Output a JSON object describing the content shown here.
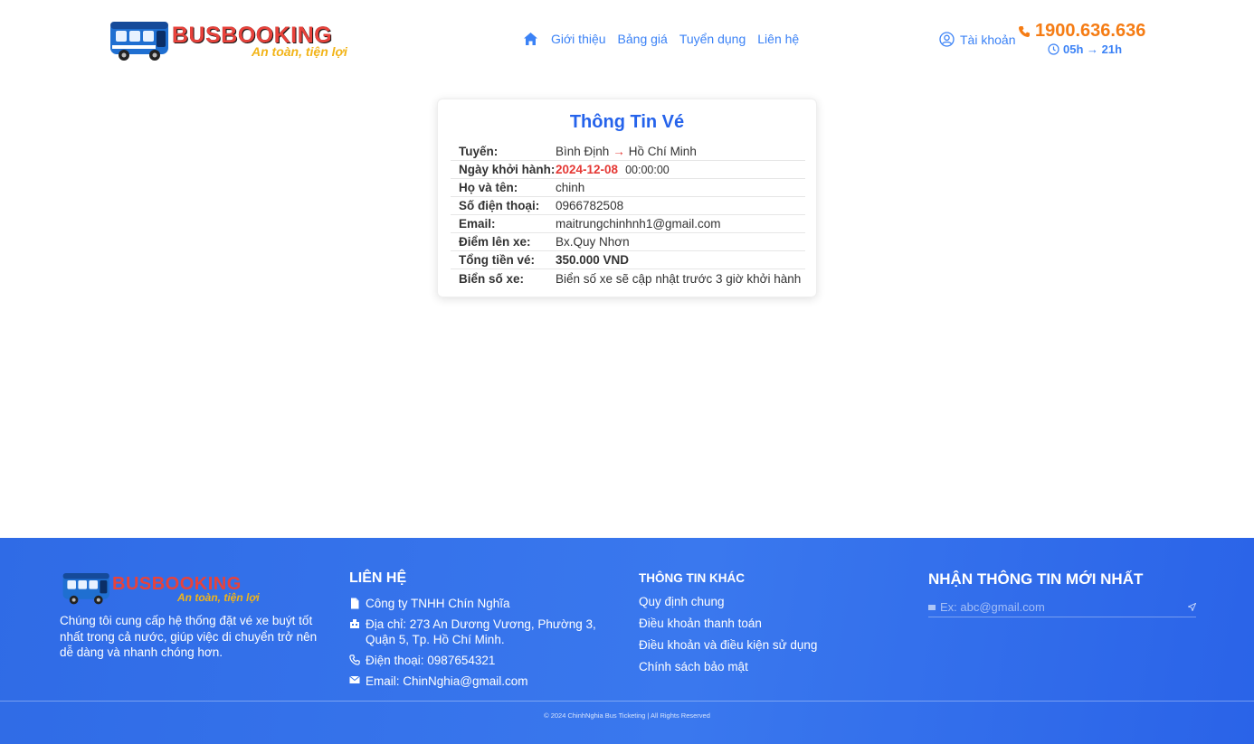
{
  "header": {
    "logo_title": "BUSBOOKING",
    "logo_slogan": "An toàn, tiện lợi",
    "nav": [
      "Giới thiệu",
      "Bảng giá",
      "Tuyển dụng",
      "Liên hệ"
    ],
    "account_label": "Tài khoản",
    "hotline": "1900.636.636",
    "hours": "05h → 21h"
  },
  "ticket": {
    "title": "Thông Tin Vé",
    "route_label": "Tuyến:",
    "route_from": "Bình Định",
    "route_arrow": "→",
    "route_to": "Hồ Chí Minh",
    "date_label": "Ngày khởi hành:",
    "date_value": "2024-12-08",
    "time_value": "00:00:00",
    "name_label": "Họ và tên:",
    "name_value": "chinh",
    "phone_label": "Số điện thoại:",
    "phone_value": "0966782508",
    "email_label": "Email:",
    "email_value": "maitrungchinhnh1@gmail.com",
    "pickup_label": "Điểm lên xe:",
    "pickup_value": "Bx.Quy Nhơn",
    "total_label": "Tổng tiền vé:",
    "total_value": "350.000 VND",
    "plate_label": "Biển số xe:",
    "plate_value": "Biển số xe sẽ cập nhật trước 3 giờ khởi hành"
  },
  "footer": {
    "logo_title": "BUSBOOKING",
    "logo_slogan": "An toàn, tiện lợi",
    "about": "Chúng tôi cung cấp hệ thống đặt vé xe buýt tốt nhất trong cả nước, giúp việc di chuyển trở nên dễ dàng và nhanh chóng hơn.",
    "contact_heading": "LIÊN HỆ",
    "company": "Công ty TNHH Chín Nghĩa",
    "address": "Địa chỉ: 273 An Dương Vương, Phường 3, Quận 5, Tp. Hồ Chí Minh.",
    "phone": "Điện thoại: 0987654321",
    "email": "Email: ChinNghia@gmail.com",
    "other_heading": "THÔNG TIN KHÁC",
    "other_links": [
      "Quy định chung",
      "Điều khoản thanh toán",
      "Điều khoản và điều kiện sử dụng",
      "Chính sách bảo mật"
    ],
    "news_heading": "NHẬN THÔNG TIN MỚI NHẤT",
    "news_placeholder": "Ex: abc@gmail.com",
    "copyright": "© 2024 ChinhNghia Bus Ticketing | All Rights Reserved"
  },
  "colors": {
    "primary_blue": "#2563eb",
    "accent_orange": "#f57c14",
    "price_red": "#e53935",
    "footer_bg": "#3374ea"
  }
}
